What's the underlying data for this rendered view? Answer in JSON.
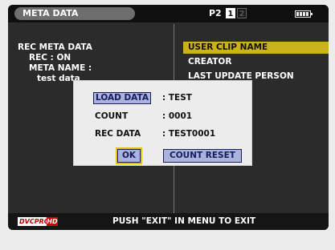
{
  "header": {
    "title": "META DATA",
    "p2_label": "P2",
    "slot_1": "1",
    "slot_2": "2",
    "battery_icon": "battery-icon"
  },
  "left_panel": {
    "heading": "REC META DATA",
    "rec_status": "REC : ON",
    "meta_name_label": "META NAME :",
    "meta_name_value": "test data"
  },
  "menu": {
    "items": [
      {
        "label": "USER CLIP NAME",
        "selected": true
      },
      {
        "label": "CREATOR",
        "selected": false
      },
      {
        "label": "LAST UPDATE PERSON",
        "selected": false
      }
    ]
  },
  "dialog": {
    "load_data_label": "LOAD DATA",
    "load_data_value": ": TEST",
    "count_label": "COUNT",
    "count_value": ": 0001",
    "rec_data_label": "REC DATA",
    "rec_data_value": ": TEST0001",
    "ok_label": "OK",
    "count_reset_label": "COUNT RESET"
  },
  "footer": {
    "badge_text": "DVCPRO",
    "badge_hd": "HD",
    "message": "PUSH \"EXIT\" IN MENU TO EXIT"
  },
  "colors": {
    "highlight": "#c9b21a",
    "button_bg": "#a9b4dd",
    "hd_red": "#d20000"
  }
}
